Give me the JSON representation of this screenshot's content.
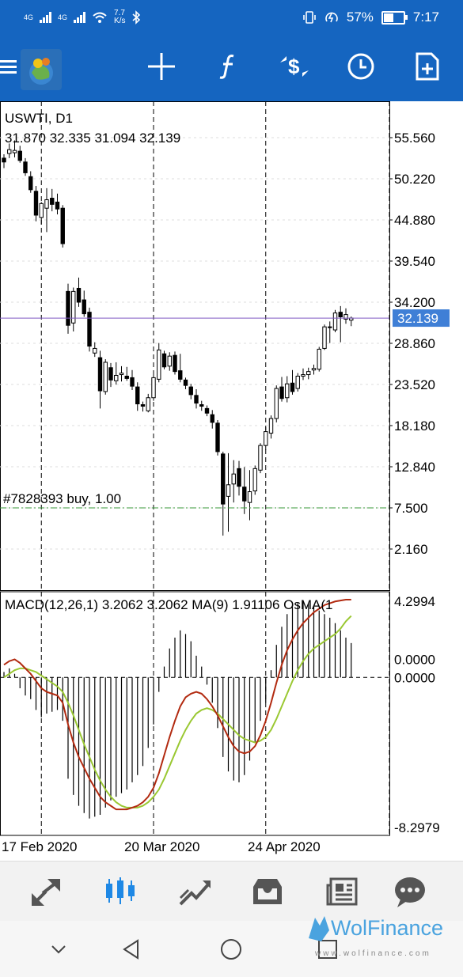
{
  "status_bar": {
    "network_1": "4G",
    "network_2": "4G",
    "speed_value": "7.7",
    "speed_unit": "K/s",
    "battery_percent": "57%",
    "battery_level": 0.57,
    "time": "7:17"
  },
  "toolbar": {
    "icons": [
      "menu-icon",
      "app-logo",
      "crosshair-icon",
      "indicators-icon",
      "trade-icon",
      "period-icon",
      "templates-icon"
    ]
  },
  "chart": {
    "symbol_header": "USWTI, D1",
    "ohlc_header": "31.870 32.335 31.094 32.139",
    "price_ticks": [
      "55.560",
      "50.220",
      "44.880",
      "39.540",
      "34.200",
      "28.860",
      "23.520",
      "18.180",
      "12.840",
      "7.500",
      "2.160"
    ],
    "current_price": "32.139",
    "order_label": "#7828393 buy, 1.00",
    "macd_header": "MACD(12,26,1) 3.2062 3.2062 MA(9) 1.91106 OsMA(1",
    "macd_ticks": [
      "4.2994",
      "0.0000",
      "0.0000",
      "-8.2979"
    ],
    "date_labels": [
      "17 Feb 2020",
      "20 Mar 2020",
      "24 Apr 2020"
    ],
    "colors": {
      "bid_line": "#7e57c2",
      "price_label_bg": "#3f7fd6",
      "order_line": "#3a9a3a",
      "macd_signal": "#b22a10",
      "macd_ma": "#9ac832"
    }
  },
  "chart_data": {
    "type": "candlestick",
    "symbol": "USWTI",
    "timeframe": "D1",
    "ohlc_last": {
      "open": 31.87,
      "high": 32.335,
      "low": 31.094,
      "close": 32.139
    },
    "ylim": [
      2.16,
      55.56
    ],
    "candles": [
      {
        "o": 52.9,
        "h": 53.4,
        "l": 51.6,
        "c": 52.4
      },
      {
        "o": 53.5,
        "h": 54.8,
        "l": 52.9,
        "c": 54.0
      },
      {
        "o": 53.6,
        "h": 55.2,
        "l": 53.0,
        "c": 53.9
      },
      {
        "o": 53.8,
        "h": 54.5,
        "l": 52.3,
        "c": 52.6
      },
      {
        "o": 52.4,
        "h": 52.9,
        "l": 50.6,
        "c": 51.0
      },
      {
        "o": 50.5,
        "h": 51.2,
        "l": 48.4,
        "c": 48.8
      },
      {
        "o": 48.6,
        "h": 49.3,
        "l": 44.7,
        "c": 45.5
      },
      {
        "o": 45.2,
        "h": 47.2,
        "l": 44.3,
        "c": 47.0
      },
      {
        "o": 46.4,
        "h": 49.0,
        "l": 43.3,
        "c": 47.5
      },
      {
        "o": 47.7,
        "h": 48.9,
        "l": 46.0,
        "c": 46.9
      },
      {
        "o": 47.2,
        "h": 48.3,
        "l": 45.6,
        "c": 46.3
      },
      {
        "o": 46.4,
        "h": 46.8,
        "l": 41.3,
        "c": 41.8
      },
      {
        "o": 35.6,
        "h": 36.6,
        "l": 30.1,
        "c": 31.2
      },
      {
        "o": 31.5,
        "h": 36.1,
        "l": 30.4,
        "c": 35.6
      },
      {
        "o": 36.0,
        "h": 37.4,
        "l": 33.6,
        "c": 34.2
      },
      {
        "o": 34.5,
        "h": 35.7,
        "l": 32.3,
        "c": 32.7
      },
      {
        "o": 32.9,
        "h": 33.5,
        "l": 27.8,
        "c": 28.5
      },
      {
        "o": 27.6,
        "h": 29.0,
        "l": 27.1,
        "c": 28.2
      },
      {
        "o": 27.0,
        "h": 27.9,
        "l": 20.4,
        "c": 22.7
      },
      {
        "o": 22.6,
        "h": 26.8,
        "l": 22.2,
        "c": 26.4
      },
      {
        "o": 25.7,
        "h": 26.3,
        "l": 23.2,
        "c": 24.1
      },
      {
        "o": 24.0,
        "h": 26.4,
        "l": 23.5,
        "c": 24.7
      },
      {
        "o": 24.8,
        "h": 25.9,
        "l": 23.9,
        "c": 25.0
      },
      {
        "o": 24.6,
        "h": 25.8,
        "l": 24.0,
        "c": 24.3
      },
      {
        "o": 24.4,
        "h": 25.4,
        "l": 22.8,
        "c": 23.3
      },
      {
        "o": 23.2,
        "h": 23.8,
        "l": 20.1,
        "c": 21.0
      },
      {
        "o": 20.9,
        "h": 21.3,
        "l": 20.0,
        "c": 20.7
      },
      {
        "o": 20.1,
        "h": 22.3,
        "l": 19.9,
        "c": 21.8
      },
      {
        "o": 21.8,
        "h": 24.8,
        "l": 21.4,
        "c": 24.4
      },
      {
        "o": 24.2,
        "h": 28.9,
        "l": 23.8,
        "c": 28.0
      },
      {
        "o": 27.5,
        "h": 27.9,
        "l": 25.5,
        "c": 25.8
      },
      {
        "o": 25.9,
        "h": 27.7,
        "l": 25.3,
        "c": 27.2
      },
      {
        "o": 27.3,
        "h": 27.8,
        "l": 24.8,
        "c": 25.2
      },
      {
        "o": 25.3,
        "h": 27.5,
        "l": 23.8,
        "c": 24.2
      },
      {
        "o": 24.1,
        "h": 24.4,
        "l": 22.9,
        "c": 23.4
      },
      {
        "o": 23.2,
        "h": 23.6,
        "l": 21.6,
        "c": 22.2
      },
      {
        "o": 22.1,
        "h": 22.9,
        "l": 20.4,
        "c": 21.1
      },
      {
        "o": 20.9,
        "h": 21.4,
        "l": 20.1,
        "c": 20.7
      },
      {
        "o": 20.4,
        "h": 20.8,
        "l": 19.4,
        "c": 19.8
      },
      {
        "o": 19.6,
        "h": 20.2,
        "l": 17.8,
        "c": 18.6
      },
      {
        "o": 18.5,
        "h": 18.9,
        "l": 14.3,
        "c": 14.8
      },
      {
        "o": 14.5,
        "h": 14.8,
        "l": 3.9,
        "c": 8.0
      },
      {
        "o": 9.0,
        "h": 14.6,
        "l": 4.4,
        "c": 10.5
      },
      {
        "o": 10.6,
        "h": 13.7,
        "l": 8.2,
        "c": 11.9
      },
      {
        "o": 12.6,
        "h": 13.6,
        "l": 9.1,
        "c": 10.3
      },
      {
        "o": 10.2,
        "h": 12.8,
        "l": 6.7,
        "c": 8.4
      },
      {
        "o": 8.2,
        "h": 12.4,
        "l": 5.9,
        "c": 9.6
      },
      {
        "o": 9.7,
        "h": 13.0,
        "l": 9.2,
        "c": 12.6
      },
      {
        "o": 12.4,
        "h": 15.9,
        "l": 12.0,
        "c": 15.6
      },
      {
        "o": 15.6,
        "h": 18.0,
        "l": 15.0,
        "c": 17.4
      },
      {
        "o": 17.2,
        "h": 19.5,
        "l": 16.5,
        "c": 19.1
      },
      {
        "o": 19.1,
        "h": 23.4,
        "l": 18.6,
        "c": 23.0
      },
      {
        "o": 23.2,
        "h": 24.5,
        "l": 21.3,
        "c": 21.7
      },
      {
        "o": 21.8,
        "h": 24.6,
        "l": 21.2,
        "c": 23.6
      },
      {
        "o": 23.7,
        "h": 25.4,
        "l": 22.2,
        "c": 22.6
      },
      {
        "o": 23.0,
        "h": 25.0,
        "l": 22.6,
        "c": 24.6
      },
      {
        "o": 24.6,
        "h": 25.6,
        "l": 24.1,
        "c": 24.8
      },
      {
        "o": 24.8,
        "h": 25.7,
        "l": 24.2,
        "c": 25.2
      },
      {
        "o": 25.4,
        "h": 26.1,
        "l": 24.8,
        "c": 25.6
      },
      {
        "o": 25.5,
        "h": 28.4,
        "l": 25.2,
        "c": 28.1
      },
      {
        "o": 28.2,
        "h": 31.3,
        "l": 28.0,
        "c": 31.0
      },
      {
        "o": 31.0,
        "h": 31.7,
        "l": 28.9,
        "c": 30.9
      },
      {
        "o": 30.6,
        "h": 33.2,
        "l": 30.3,
        "c": 32.8
      },
      {
        "o": 32.9,
        "h": 33.7,
        "l": 29.0,
        "c": 32.3
      },
      {
        "o": 32.0,
        "h": 33.4,
        "l": 31.4,
        "c": 32.6
      },
      {
        "o": 31.87,
        "h": 32.335,
        "l": 31.094,
        "c": 32.139
      }
    ],
    "current_price": 32.139,
    "order_level": 7.5,
    "dates": [
      "17 Feb 2020",
      "20 Mar 2020",
      "24 Apr 2020"
    ],
    "date_index": [
      7,
      28,
      49
    ],
    "macd": {
      "params": "12,26,1",
      "ylim": [
        -8.2979,
        4.2994
      ],
      "zero_level": 0.0,
      "histogram": [
        0.3,
        0.5,
        0.2,
        -0.6,
        -1.0,
        -1.2,
        -1.8,
        -2.2,
        -2.0,
        -1.9,
        -1.8,
        -2.4,
        -5.6,
        -6.5,
        -7.1,
        -7.5,
        -7.8,
        -7.7,
        -7.6,
        -7.2,
        -6.8,
        -6.6,
        -6.4,
        -6.2,
        -5.8,
        -5.4,
        -4.9,
        -3.9,
        -2.6,
        -0.8,
        0.6,
        1.6,
        2.2,
        2.6,
        2.4,
        2.0,
        1.2,
        0.6,
        -0.4,
        -1.4,
        -2.8,
        -4.4,
        -5.2,
        -5.7,
        -5.8,
        -5.4,
        -4.6,
        -3.6,
        -2.4,
        -1.4,
        0.4,
        1.8,
        2.8,
        3.5,
        3.9,
        4.1,
        4.2,
        4.1,
        3.9,
        3.7,
        3.5,
        3.3,
        3.0,
        2.6,
        2.2,
        1.9
      ],
      "signal": [
        0.7,
        0.9,
        1.0,
        0.8,
        0.5,
        0.2,
        -0.2,
        -0.6,
        -0.8,
        -0.9,
        -1.0,
        -1.4,
        -2.6,
        -3.6,
        -4.4,
        -5.0,
        -5.6,
        -6.1,
        -6.6,
        -6.9,
        -7.1,
        -7.3,
        -7.3,
        -7.3,
        -7.2,
        -7.1,
        -6.9,
        -6.6,
        -6.1,
        -5.3,
        -4.3,
        -3.3,
        -2.4,
        -1.6,
        -1.1,
        -0.9,
        -0.8,
        -0.9,
        -1.2,
        -1.6,
        -2.1,
        -2.7,
        -3.3,
        -3.8,
        -4.1,
        -4.2,
        -4.1,
        -3.8,
        -3.2,
        -2.4,
        -1.4,
        -0.3,
        0.7,
        1.5,
        2.1,
        2.6,
        3.0,
        3.3,
        3.6,
        3.8,
        4.0,
        4.1,
        4.2,
        4.25,
        4.3,
        4.3
      ],
      "ma": [
        0.0,
        0.2,
        0.4,
        0.5,
        0.5,
        0.4,
        0.3,
        0.1,
        -0.1,
        -0.3,
        -0.5,
        -0.8,
        -1.4,
        -2.1,
        -2.9,
        -3.7,
        -4.4,
        -5.1,
        -5.7,
        -6.2,
        -6.6,
        -6.9,
        -7.1,
        -7.2,
        -7.2,
        -7.2,
        -7.1,
        -6.9,
        -6.6,
        -6.2,
        -5.6,
        -4.9,
        -4.2,
        -3.5,
        -2.9,
        -2.4,
        -2.0,
        -1.8,
        -1.7,
        -1.8,
        -2.0,
        -2.3,
        -2.6,
        -2.9,
        -3.2,
        -3.4,
        -3.5,
        -3.6,
        -3.5,
        -3.3,
        -2.9,
        -2.3,
        -1.6,
        -0.9,
        -0.2,
        0.4,
        0.9,
        1.3,
        1.6,
        1.8,
        2.0,
        2.2,
        2.4,
        2.7,
        3.1,
        3.4
      ]
    }
  },
  "bottom_tabs": {
    "icons": [
      "quotes-icon",
      "chart-icon",
      "trade-tab-icon",
      "history-icon",
      "news-icon",
      "messages-icon"
    ]
  },
  "watermark": {
    "brand": "WolFinance",
    "url": "www.wolfinance.com"
  }
}
